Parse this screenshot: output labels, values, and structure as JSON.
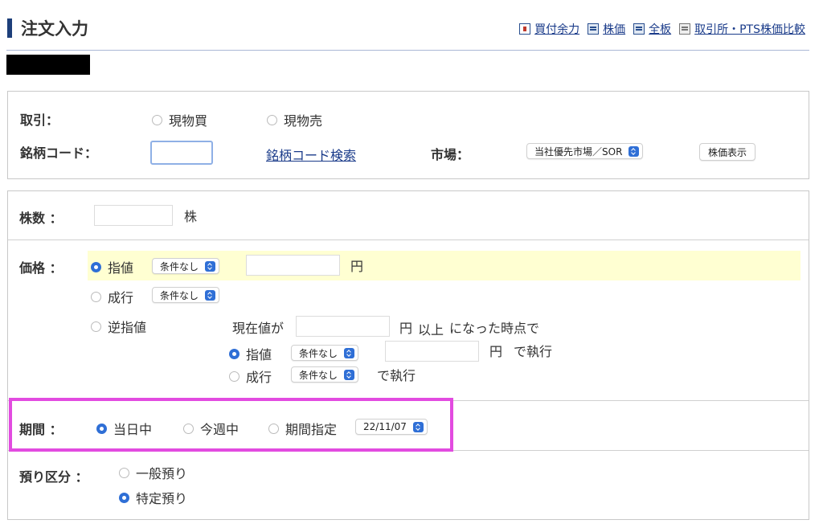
{
  "header": {
    "title": "注文入力",
    "links": [
      {
        "label": "買付余力",
        "icon": "buying-power-icon"
      },
      {
        "label": "株価",
        "icon": "stock-price-icon"
      },
      {
        "label": "全板",
        "icon": "full-board-icon"
      },
      {
        "label": "取引所・PTS株価比較",
        "icon": "compare-icon"
      }
    ]
  },
  "trade": {
    "label": "取引：",
    "options": [
      "現物買",
      "現物売"
    ]
  },
  "code": {
    "label": "銘柄コード：",
    "value": "",
    "search_link": "銘柄コード検索"
  },
  "market": {
    "label": "市場：",
    "selected": "当社優先市場／SOR",
    "button": "株価表示"
  },
  "shares": {
    "label": "株数 ：",
    "unit": "株"
  },
  "price": {
    "label": "価格 ：",
    "limit": {
      "label": "指値",
      "condition": "条件なし",
      "unit": "円"
    },
    "market_order": {
      "label": "成行",
      "condition": "条件なし"
    },
    "stop": {
      "label": "逆指値",
      "trigger_prefix": "現在値が",
      "trigger_unit": "円",
      "trigger_suffix_a": "以上",
      "trigger_suffix_b": "になった時点で",
      "limit": {
        "label": "指値",
        "condition": "条件なし",
        "unit": "円",
        "exec": "で執行"
      },
      "market": {
        "label": "成行",
        "condition": "条件なし",
        "exec": "で執行"
      }
    }
  },
  "period": {
    "label": "期間 ：",
    "options": [
      "当日中",
      "今週中",
      "期間指定"
    ],
    "date": "22/11/07"
  },
  "deposit": {
    "label": "預り区分 ：",
    "options": [
      "一般預り",
      "特定預り"
    ]
  },
  "colors": {
    "accent": "#2f6fd6",
    "highlight": "#e24be0",
    "price_row": "#ffffd2"
  }
}
